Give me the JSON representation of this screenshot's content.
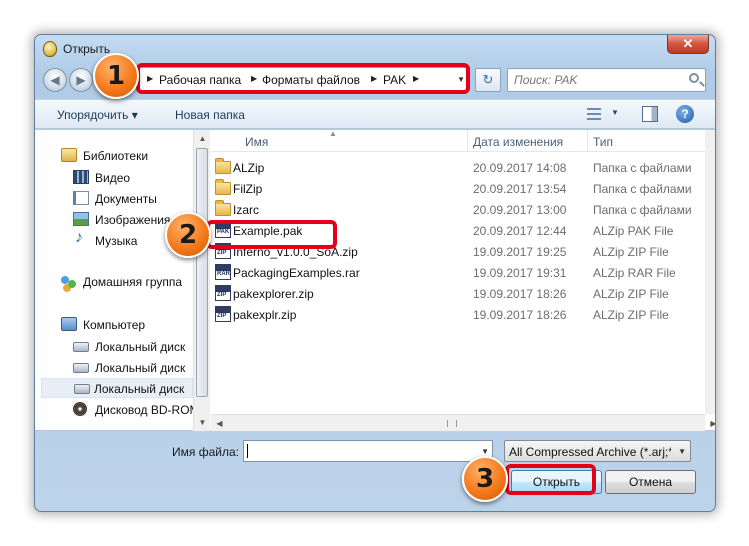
{
  "window": {
    "title": "Открыть",
    "close_glyph": "✕"
  },
  "navigation": {
    "back_glyph": "◀",
    "forward_glyph": "▶",
    "breadcrumb": [
      "Рабочая папка",
      "Форматы файлов",
      "PAK"
    ],
    "refresh_glyph": "↻",
    "search_placeholder": "Поиск: PAK"
  },
  "toolbar": {
    "organize_label": "Упорядочить ▾",
    "new_folder_label": "Новая папка",
    "help_glyph": "?"
  },
  "sidebar": {
    "items": [
      {
        "label": "Библиотеки",
        "icon": "library-icon"
      },
      {
        "label": "Видео",
        "icon": "video-icon"
      },
      {
        "label": "Документы",
        "icon": "documents-icon"
      },
      {
        "label": "Изображения",
        "icon": "pictures-icon"
      },
      {
        "label": "Музыка",
        "icon": "music-icon"
      },
      {
        "label": "Домашняя группа",
        "icon": "homegroup-icon"
      },
      {
        "label": "Компьютер",
        "icon": "computer-icon"
      },
      {
        "label": "Локальный диск",
        "icon": "local-disk-icon"
      },
      {
        "label": "Локальный диск",
        "icon": "local-disk-icon"
      },
      {
        "label": "Локальный диск",
        "icon": "local-disk-icon"
      },
      {
        "label": "Дисковод BD-ROM",
        "icon": "bd-rom-icon"
      }
    ]
  },
  "columns": {
    "name": "Имя",
    "date": "Дата изменения",
    "type": "Тип"
  },
  "files": [
    {
      "name": "ALZip",
      "date": "20.09.2017 14:08",
      "type": "Папка с файлами",
      "icon": "folder-icon"
    },
    {
      "name": "FilZip",
      "date": "20.09.2017 13:54",
      "type": "Папка с файлами",
      "icon": "folder-icon"
    },
    {
      "name": "Izarc",
      "date": "20.09.2017 13:00",
      "type": "Папка с файлами",
      "icon": "folder-icon"
    },
    {
      "name": "Example.pak",
      "date": "20.09.2017 12:44",
      "type": "ALZip PAK File",
      "icon": "pak-file-icon"
    },
    {
      "name": "Inferno_v1.0.0_SoA.zip",
      "date": "19.09.2017 19:25",
      "type": "ALZip ZIP File",
      "icon": "zip-file-icon"
    },
    {
      "name": "PackagingExamples.rar",
      "date": "19.09.2017 19:31",
      "type": "ALZip RAR File",
      "icon": "rar-file-icon"
    },
    {
      "name": "pakexplorer.zip",
      "date": "19.09.2017 18:26",
      "type": "ALZip ZIP File",
      "icon": "zip-file-icon"
    },
    {
      "name": "pakexplr.zip",
      "date": "19.09.2017 18:26",
      "type": "ALZip ZIP File",
      "icon": "zip-file-icon"
    }
  ],
  "footer": {
    "filename_label": "Имя файла:",
    "filename_value": "",
    "filter_value": "All Compressed Archive (*.arj;*.",
    "open_label": "Открыть",
    "cancel_label": "Отмена"
  },
  "annotations": {
    "step1": "1",
    "step2": "2",
    "step3": "3",
    "highlight_color": "#e4001a",
    "badge_color": "#f57a1c"
  }
}
